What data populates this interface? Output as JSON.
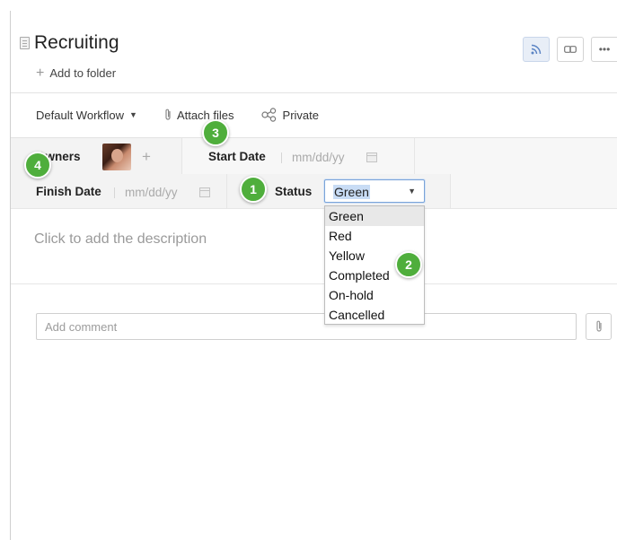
{
  "task": {
    "title": "Recruiting",
    "add_to_folder": "Add to folder"
  },
  "toolbar": {
    "workflow": "Default Workflow",
    "attach": "Attach files",
    "privacy": "Private"
  },
  "fields": {
    "owners_label": "Owners",
    "start_label": "Start Date",
    "start_placeholder": "mm/dd/yy",
    "finish_label": "Finish Date",
    "finish_placeholder": "mm/dd/yy",
    "status_label": "Status",
    "status_value": "Green",
    "status_options": [
      "Green",
      "Red",
      "Yellow",
      "Completed",
      "On-hold",
      "Cancelled"
    ]
  },
  "description": {
    "placeholder": "Click to add the description"
  },
  "comment": {
    "placeholder": "Add comment"
  },
  "badges": [
    "1",
    "2",
    "3",
    "4"
  ],
  "colors": {
    "accent_green": "#4aa84a",
    "badge_green": "#4fae3c",
    "select_border": "#7aa3d8"
  }
}
